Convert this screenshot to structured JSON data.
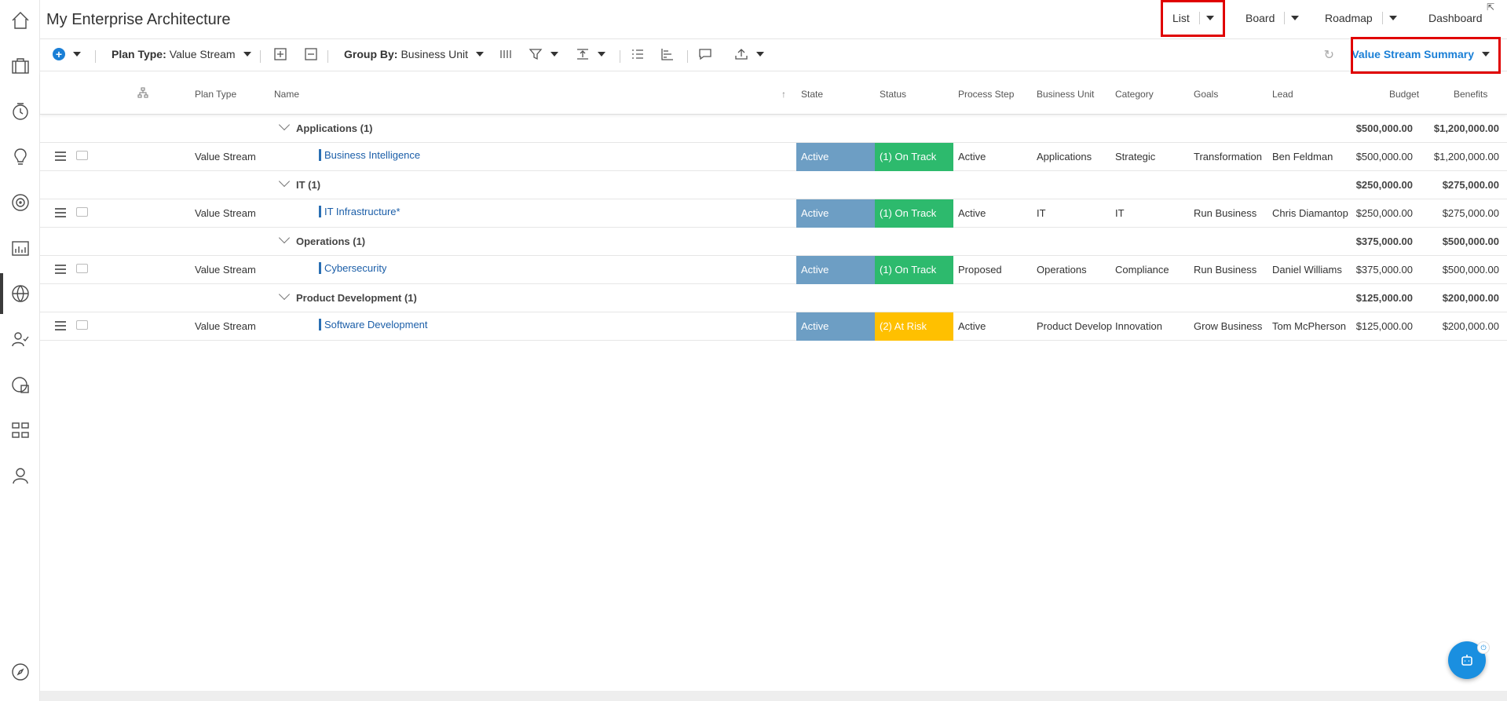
{
  "app": {
    "title": "My Enterprise Architecture"
  },
  "views": {
    "list": "List",
    "board": "Board",
    "roadmap": "Roadmap",
    "dashboard": "Dashboard"
  },
  "toolbar": {
    "plan_type_label": "Plan Type:",
    "plan_type_value": "Value Stream",
    "group_by_label": "Group By:",
    "group_by_value": "Business Unit",
    "summary_view": "Value Stream Summary"
  },
  "columns": {
    "plan_type": "Plan Type",
    "name": "Name",
    "state": "State",
    "status": "Status",
    "process_step": "Process Step",
    "business_unit": "Business Unit",
    "category": "Category",
    "goals": "Goals",
    "lead": "Lead",
    "budget": "Budget",
    "benefits": "Benefits"
  },
  "groups": [
    {
      "label": "Applications (1)",
      "budget": "$500,000.00",
      "benefits": "$1,200,000.00",
      "row": {
        "plan_type": "Value Stream",
        "name": "Business Intelligence",
        "state": "Active",
        "status": "(1) On Track",
        "status_color": "#2dba6d",
        "process_step": "Active",
        "business_unit": "Applications",
        "category": "Strategic",
        "goals": "Transformation",
        "lead": "Ben Feldman",
        "budget": "$500,000.00",
        "benefits": "$1,200,000.00"
      }
    },
    {
      "label": "IT (1)",
      "budget": "$250,000.00",
      "benefits": "$275,000.00",
      "row": {
        "plan_type": "Value Stream",
        "name": "IT Infrastructure*",
        "state": "Active",
        "status": "(1) On Track",
        "status_color": "#2dba6d",
        "process_step": "Active",
        "business_unit": "IT",
        "category": "IT",
        "goals": "Run Business",
        "lead": "Chris Diamantop",
        "budget": "$250,000.00",
        "benefits": "$275,000.00"
      }
    },
    {
      "label": "Operations (1)",
      "budget": "$375,000.00",
      "benefits": "$500,000.00",
      "row": {
        "plan_type": "Value Stream",
        "name": "Cybersecurity",
        "state": "Active",
        "status": "(1) On Track",
        "status_color": "#2dba6d",
        "process_step": "Proposed",
        "business_unit": "Operations",
        "category": "Compliance",
        "goals": "Run Business",
        "lead": "Daniel Williams",
        "budget": "$375,000.00",
        "benefits": "$500,000.00"
      }
    },
    {
      "label": "Product Development (1)",
      "budget": "$125,000.00",
      "benefits": "$200,000.00",
      "row": {
        "plan_type": "Value Stream",
        "name": "Software Development",
        "state": "Active",
        "status": "(2) At Risk",
        "status_color": "#ffc000",
        "process_step": "Active",
        "business_unit": "Product Develop",
        "category": "Innovation",
        "goals": "Grow Business",
        "lead": "Tom McPherson",
        "budget": "$125,000.00",
        "benefits": "$200,000.00"
      }
    }
  ],
  "icons": {
    "sidebar": [
      "home-icon",
      "briefcase-icon",
      "clock-icon",
      "lightbulb-icon",
      "target-icon",
      "chart-icon",
      "globe-icon",
      "people-check-icon",
      "report-icon",
      "hierarchy-icon",
      "user-icon",
      "compass-icon"
    ]
  },
  "colors": {
    "accent": "#1a7fd6",
    "state_active": "#6d9ec4",
    "on_track": "#2dba6d",
    "at_risk": "#ffc000",
    "highlight": "#e00000"
  }
}
